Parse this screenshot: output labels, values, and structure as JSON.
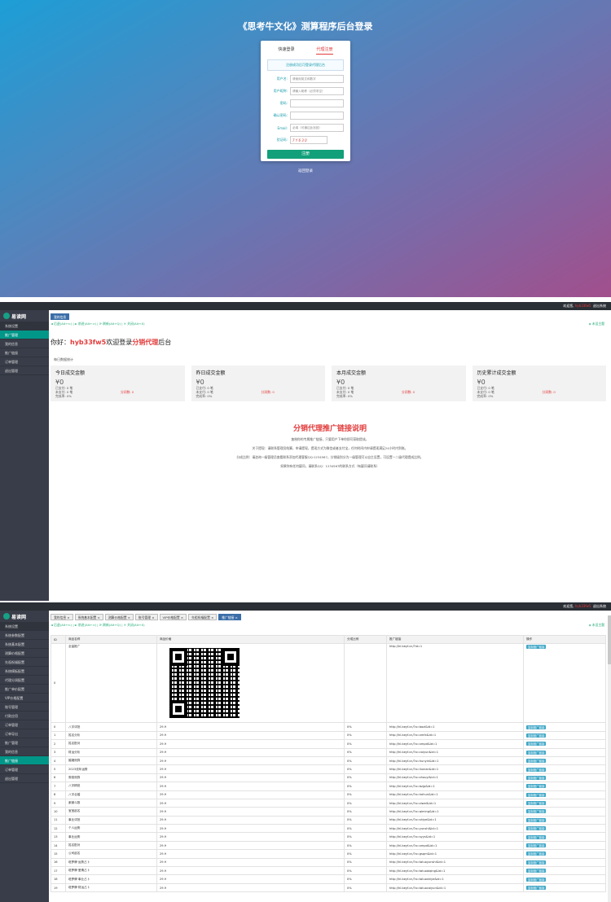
{
  "login": {
    "title": "《思考牛文化》测算程序后台登录",
    "tabs": [
      "快速登录",
      "代理注册"
    ],
    "notice": "注册成功后可登录代理后台",
    "fields": [
      {
        "label": "用户名:",
        "value": "请使用英文和数字"
      },
      {
        "label": "用户昵称:",
        "value": "请输入昵称（必须非空）"
      },
      {
        "label": "密码:",
        "value": ""
      },
      {
        "label": "确认密码:",
        "value": ""
      },
      {
        "label": "Email:",
        "value": "必填（可通过此找回）"
      },
      {
        "label": "验证码:",
        "value": "7 Y 6 3 0"
      }
    ],
    "register_btn": "注册",
    "back_link": "返回登录"
  },
  "admin2": {
    "topbar_left": "",
    "topbar_user_label": "欢迎您,",
    "topbar_user": "hyb33fw5",
    "topbar_logout": "退出系统",
    "logo": "易读网",
    "side_head": "系统设置",
    "side_items": [
      "推广管理",
      "我的信息",
      "推广链接",
      "订单管理",
      "退出管理"
    ],
    "tab": "我的信息",
    "toolbar": "◄ 后退(Alt+⇐) | ► 前进(Alt+⇒) | ⟳ 刷新(Alt+Q) | ✕ 关闭(Alt+X)",
    "toolbar_right": "◈ 未设主题",
    "hello_pre": "你好：",
    "hello_user": "hyb33fw5",
    "hello_mid": "欢迎登录",
    "hello_role": "分销代理",
    "hello_post": "后台",
    "stats_label": "每日数据统计",
    "cards": [
      {
        "title": "今日成交金额",
        "amount": "¥0",
        "l1": "已支付: 0 笔",
        "l2": "未支付: 0 笔",
        "l3": "完成率: 0%",
        "share": "分润数: 0"
      },
      {
        "title": "昨日成交金额",
        "amount": "¥0",
        "l1": "已支付: 0 笔",
        "l2": "未支付: 0 笔",
        "l3": "完成率: 0%",
        "share": "分润数: 0"
      },
      {
        "title": "本月成交金额",
        "amount": "¥0",
        "l1": "已支付: 0 笔",
        "l2": "未支付: 0 笔",
        "l3": "完成率: 0%",
        "share": "分润数: 0"
      },
      {
        "title": "历史累计成交金额",
        "amount": "¥0",
        "l1": "已支付: 0 笔",
        "l2": "未支付: 0 笔",
        "l3": "完成率: 0%",
        "share": "分润数: 0"
      }
    ],
    "promo_title": "分销代理推广链接说明",
    "promo_lines": [
      "复制你的专属推广链接，只要用户下单你即可获取提成。",
      "关于提现：请联系管理员结算，申请提现，提现方式为微信或者支付宝，任何时间内申请提现满足24小时内到账。",
      "分成比例：请咨询一级管理员查看联系添加代理客服QQ:1234567，分销级别分为一级管理可以自主设置，可设置一二级代理提成比例。",
      "如果你有任何疑问，请联系QQ：1234567的联系方式（有疑问请联系）"
    ]
  },
  "admin3": {
    "topbar_user_label": "欢迎您,",
    "topbar_user": "hyb33fw5",
    "topbar_logout": "退出系统",
    "logo": "易读网",
    "side_head": "系统设置",
    "side_items": [
      "系统参数配置",
      "系统基本配置",
      "测算价格配置",
      "先祖祝福配置",
      "系统模板配置",
      "代理分润配置",
      "推广单价配置",
      "VIP价格配置",
      "账号管理",
      "付款应用",
      "订单管理",
      "订单导出",
      "推广管理",
      "我的信息",
      "推广链接",
      "订单管理",
      "退出管理"
    ],
    "side_active": 14,
    "tabs": [
      "我的信息 ×",
      "系统基本配置 ×",
      "测算价格配置 ×",
      "账号管理 ×",
      "VIP价格配置 ×",
      "先祖祝福配置 ×",
      "推广链接 ×"
    ],
    "toolbar": "◄ 后退(Alt+⇐) | ► 前进(Alt+⇒) | ⟳ 刷新(Alt+Q) | ✕ 关闭(Alt+X)",
    "toolbar_right": "◈ 未设主题",
    "headers": [
      "ID",
      "商品名称",
      "商品价格",
      "分成比例",
      "推广链接",
      "操作"
    ],
    "first_row": {
      "id": "0",
      "name": "全量推广",
      "price": "",
      "ratio": "",
      "link": "http://hl.beyf.cn/?id=1",
      "btn": "复制推广链接"
    },
    "rows": [
      {
        "id": "0",
        "name": "八字详批",
        "price": "29.9",
        "ratio": "0%",
        "link": "http://hl.beyf.cn/?a=bazi&id=1"
      },
      {
        "id": "1",
        "name": "姓名分析",
        "price": "29.9",
        "ratio": "0%",
        "link": "http://hl.beyf.cn/?a=xmfx&id=1"
      },
      {
        "id": "2",
        "name": "姓名配对",
        "price": "29.9",
        "ratio": "0%",
        "link": "http://hl.beyf.cn/?a=xmpd&id=1"
      },
      {
        "id": "3",
        "name": "财运分析",
        "price": "29.9",
        "ratio": "0%",
        "link": "http://hl.beyf.cn/?a=caiyun&id=1"
      },
      {
        "id": "4",
        "name": "婚姻测算",
        "price": "29.9",
        "ratio": "0%",
        "link": "http://hl.beyf.cn/?a=hunyin&id=1"
      },
      {
        "id": "5",
        "name": "2023流年运势",
        "price": "29.9",
        "ratio": "0%",
        "link": "http://hl.beyf.cn/?a=liunian&id=1"
      },
      {
        "id": "6",
        "name": "周易测算",
        "price": "29.9",
        "ratio": "0%",
        "link": "http://hl.beyf.cn/?a=zhouyi&id=1"
      },
      {
        "id": "7",
        "name": "八字精批",
        "price": "29.9",
        "ratio": "0%",
        "link": "http://hl.beyf.cn/?a=bzjp&id=1"
      },
      {
        "id": "8",
        "name": "八字合婚",
        "price": "29.9",
        "ratio": "0%",
        "link": "http://hl.beyf.cn/?a=hehun&id=1"
      },
      {
        "id": "9",
        "name": "紫微斗数",
        "price": "29.9",
        "ratio": "0%",
        "link": "http://hl.beyf.cn/?a=ziwei&id=1"
      },
      {
        "id": "10",
        "name": "宝宝起名",
        "price": "29.9",
        "ratio": "0%",
        "link": "http://hl.beyf.cn/?a=qiming&id=1"
      },
      {
        "id": "11",
        "name": "事业详批",
        "price": "29.9",
        "ratio": "0%",
        "link": "http://hl.beyf.cn/?a=shiye&id=1"
      },
      {
        "id": "12",
        "name": "个人运势",
        "price": "29.9",
        "ratio": "0%",
        "link": "http://hl.beyf.cn/?a=yunshi&id=1"
      },
      {
        "id": "13",
        "name": "事业运势",
        "price": "29.9",
        "ratio": "0%",
        "link": "http://hl.beyf.cn/?a=syys&id=1"
      },
      {
        "id": "14",
        "name": "姓名配对",
        "price": "29.9",
        "ratio": "0%",
        "link": "http://hl.beyf.cn/?a=xmpd&id=1"
      },
      {
        "id": "15",
        "name": "公司起名",
        "price": "29.9",
        "ratio": "0%",
        "link": "http://hl.beyf.cn/?a=gsqm&id=1"
      },
      {
        "id": "16",
        "name": "塔罗牌·运势占卜",
        "price": "29.9",
        "ratio": "0%",
        "link": "http://hl.beyf.cn/?a=taluoyunshi&id=1"
      },
      {
        "id": "17",
        "name": "塔罗牌·爱情占卜",
        "price": "29.9",
        "ratio": "0%",
        "link": "http://hl.beyf.cn/?a=taluoaiqing&id=1"
      },
      {
        "id": "18",
        "name": "塔罗牌·事业占卜",
        "price": "29.9",
        "ratio": "0%",
        "link": "http://hl.beyf.cn/?a=taluoshiye&id=1"
      },
      {
        "id": "19",
        "name": "塔罗牌·财运占卜",
        "price": "29.9",
        "ratio": "0%",
        "link": "http://hl.beyf.cn/?a=taluocaiyun&id=1"
      }
    ],
    "row_btn": "复制推广链接"
  },
  "colors": {
    "accent": "#009688",
    "red": "#e23b3b",
    "sidebar": "#393d49",
    "topbar": "#2b2f36",
    "green_btn": "#12a07a"
  }
}
